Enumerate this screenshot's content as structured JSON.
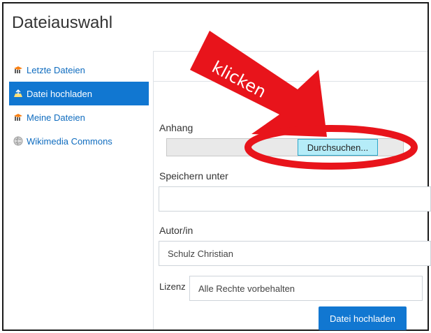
{
  "window": {
    "title": "Dateiauswahl"
  },
  "sidebar": {
    "items": [
      {
        "label": "Letzte Dateien",
        "icon": "moodle-hat-icon",
        "active": false
      },
      {
        "label": "Datei hochladen",
        "icon": "upload-icon",
        "active": true
      },
      {
        "label": "Meine Dateien",
        "icon": "moodle-hat-icon",
        "active": false
      },
      {
        "label": "Wikimedia Commons",
        "icon": "globe-icon",
        "active": false
      }
    ]
  },
  "form": {
    "attachment_label": "Anhang",
    "browse_label": "Durchsuchen...",
    "save_as_label": "Speichern unter",
    "save_as_value": "",
    "author_label": "Autor/in",
    "author_value": "Schulz Christian",
    "license_label": "Lizenz",
    "license_value": "Alle Rechte vorbehalten",
    "upload_button_label": "Datei hochladen"
  },
  "annotation": {
    "text": "klicken",
    "color": "#e8141b"
  },
  "colors": {
    "accent": "#1177d1",
    "link": "#0f6cbf",
    "browse_bg": "#b5ecf8"
  }
}
